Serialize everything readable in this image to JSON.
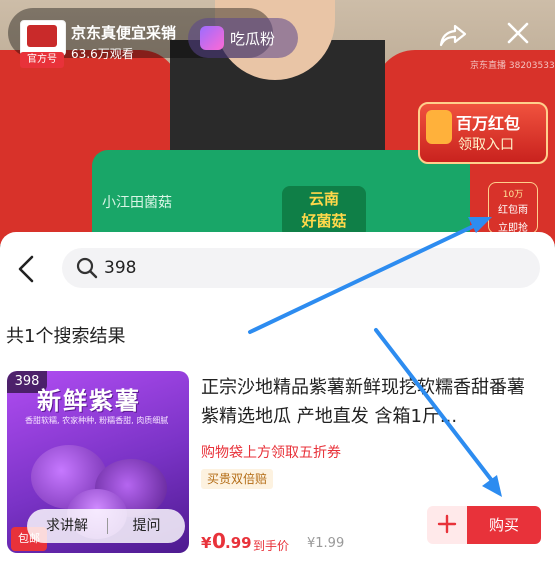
{
  "live": {
    "host_name": "京东真便宜采销",
    "official_badge": "官方号",
    "viewers": "63.6万观看",
    "fan_button": "吃瓜粉",
    "watermark": "京东直播 38203533",
    "bag_brand": "小江田菌菇",
    "bag_label_line1": "云南",
    "bag_label_line2": "好菌菇",
    "red_packet": {
      "line1": "百万红包",
      "line2": "领取入口"
    },
    "rain_badge": {
      "top": "10万",
      "mid": "红包雨",
      "bottom": "立即抢"
    },
    "icons": {
      "share": "share-icon",
      "close": "close-icon"
    }
  },
  "search": {
    "query": "398",
    "result_count": "共1个搜索结果"
  },
  "product": {
    "index": "398",
    "thumb_title": "新鲜紫薯",
    "thumb_sub": "香甜软糯, 农家种种, 粉糯香甜, 肉质细腻",
    "free_shipping": "包邮",
    "explain_button": "求讲解",
    "ask_button": "提问",
    "title": "正宗沙地精品紫薯新鲜现挖软糯香甜番薯紫精选地瓜 产地直发 含箱1斤...",
    "coupon": "购物袋上方领取五折券",
    "guarantee": "买贵双倍赔",
    "price_symbol": "¥",
    "price_int": "0",
    "price_dec": ".99",
    "price_tag": "到手价",
    "original_price": "¥1.99",
    "buy_button": "购买"
  },
  "colors": {
    "accent": "#e8323a",
    "annotation_arrow": "#2d8cf0"
  }
}
